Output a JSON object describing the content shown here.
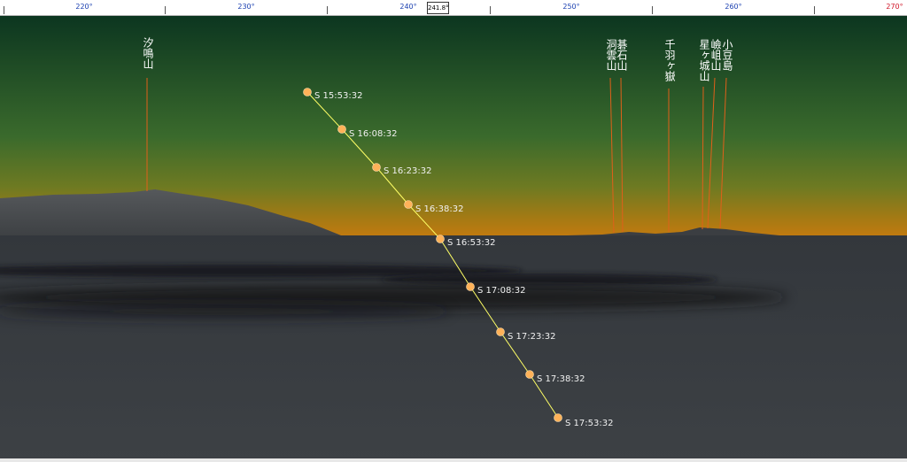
{
  "compass": {
    "degrees": [
      "220°",
      "230°",
      "240°",
      "250°",
      "260°",
      "270°"
    ],
    "cursor_readout": "241.8°"
  },
  "mountains": [
    {
      "label": "汐鳴山"
    },
    {
      "label": "洞雲山"
    },
    {
      "label": "碁石山"
    },
    {
      "label": "千羽ヶ嶽"
    },
    {
      "label": "星ヶ城山"
    },
    {
      "label": "嶮岨山"
    },
    {
      "label": "小豆島"
    }
  ],
  "sun_path": [
    {
      "label": "S 15:53:32"
    },
    {
      "label": "S 16:08:32"
    },
    {
      "label": "S 16:23:32"
    },
    {
      "label": "S 16:38:32"
    },
    {
      "label": "S 16:53:32"
    },
    {
      "label": "S 17:08:32"
    },
    {
      "label": "S 17:23:32"
    },
    {
      "label": "S 17:38:32"
    },
    {
      "label": "S 17:53:32"
    }
  ],
  "colors": {
    "sky_top": "#0c3620",
    "sky_mid": "#3c6a2a",
    "horizon_glow": "#c07a10",
    "sea": "#3a3e43",
    "land": "#4a4d51",
    "sun_marker": "#ffb259",
    "path_line": "#ffff66",
    "leader_line": "#e0601a",
    "degree_label": "#1a3fb0",
    "degree_label_end": "#d0182a"
  }
}
